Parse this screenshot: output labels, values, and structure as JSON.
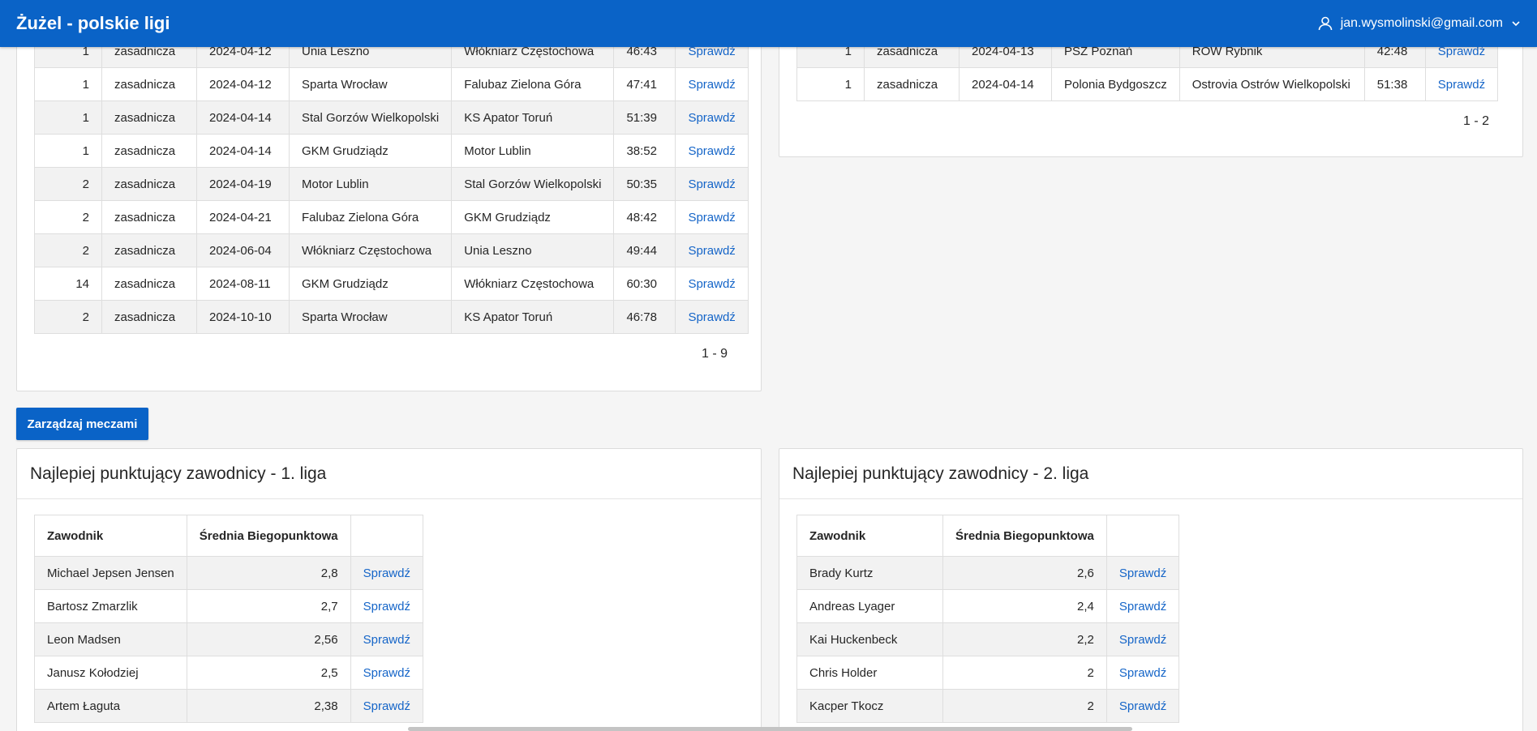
{
  "app": {
    "title": "Żużel - polskie ligi",
    "user": "jan.wysmolinski@gmail.com"
  },
  "matches_left": {
    "link_label": "Sprawdź",
    "rows": [
      {
        "round": "1",
        "phase": "zasadnicza",
        "date": "2024-04-12",
        "home": "Unia Leszno",
        "away": "Włókniarz Częstochowa",
        "score": "46:43"
      },
      {
        "round": "1",
        "phase": "zasadnicza",
        "date": "2024-04-12",
        "home": "Sparta Wrocław",
        "away": "Falubaz Zielona Góra",
        "score": "47:41"
      },
      {
        "round": "1",
        "phase": "zasadnicza",
        "date": "2024-04-14",
        "home": "Stal Gorzów Wielkopolski",
        "away": "KS Apator Toruń",
        "score": "51:39"
      },
      {
        "round": "1",
        "phase": "zasadnicza",
        "date": "2024-04-14",
        "home": "GKM Grudziądz",
        "away": "Motor Lublin",
        "score": "38:52"
      },
      {
        "round": "2",
        "phase": "zasadnicza",
        "date": "2024-04-19",
        "home": "Motor Lublin",
        "away": "Stal Gorzów Wielkopolski",
        "score": "50:35"
      },
      {
        "round": "2",
        "phase": "zasadnicza",
        "date": "2024-04-21",
        "home": "Falubaz Zielona Góra",
        "away": "GKM Grudziądz",
        "score": "48:42"
      },
      {
        "round": "2",
        "phase": "zasadnicza",
        "date": "2024-06-04",
        "home": "Włókniarz Częstochowa",
        "away": "Unia Leszno",
        "score": "49:44"
      },
      {
        "round": "14",
        "phase": "zasadnicza",
        "date": "2024-08-11",
        "home": "GKM Grudziądz",
        "away": "Włókniarz Częstochowa",
        "score": "60:30"
      },
      {
        "round": "2",
        "phase": "zasadnicza",
        "date": "2024-10-10",
        "home": "Sparta Wrocław",
        "away": "KS Apator Toruń",
        "score": "46:78"
      }
    ],
    "pagination": "1 - 9"
  },
  "matches_right": {
    "link_label": "Sprawdź",
    "rows": [
      {
        "round": "1",
        "phase": "zasadnicza",
        "date": "2024-04-13",
        "home": "PSZ Poznań",
        "away": "ROW Rybnik",
        "score": "42:48"
      },
      {
        "round": "1",
        "phase": "zasadnicza",
        "date": "2024-04-14",
        "home": "Polonia Bydgoszcz",
        "away": "Ostrovia Ostrów Wielkopolski",
        "score": "51:38"
      }
    ],
    "pagination": "1 - 2"
  },
  "manage_button": "Zarządzaj meczami",
  "league1": {
    "title": "Najlepiej punktujący zawodnicy - 1. liga",
    "col_rider": "Zawodnik",
    "col_avg": "Średnia Biegopunktowa",
    "link_label": "Sprawdź",
    "rows": [
      {
        "name": "Michael Jepsen Jensen",
        "avg": "2,8"
      },
      {
        "name": "Bartosz Zmarzlik",
        "avg": "2,7"
      },
      {
        "name": "Leon Madsen",
        "avg": "2,56"
      },
      {
        "name": "Janusz Kołodziej",
        "avg": "2,5"
      },
      {
        "name": "Artem Łaguta",
        "avg": "2,38"
      }
    ]
  },
  "league2": {
    "title": "Najlepiej punktujący zawodnicy - 2. liga",
    "col_rider": "Zawodnik",
    "col_avg": "Średnia Biegopunktowa",
    "link_label": "Sprawdź",
    "rows": [
      {
        "name": "Brady Kurtz",
        "avg": "2,6"
      },
      {
        "name": "Andreas Lyager",
        "avg": "2,4"
      },
      {
        "name": "Kai Huckenbeck",
        "avg": "2,2"
      },
      {
        "name": "Chris Holder",
        "avg": "2"
      },
      {
        "name": "Kacper Tkocz",
        "avg": "2"
      }
    ]
  }
}
